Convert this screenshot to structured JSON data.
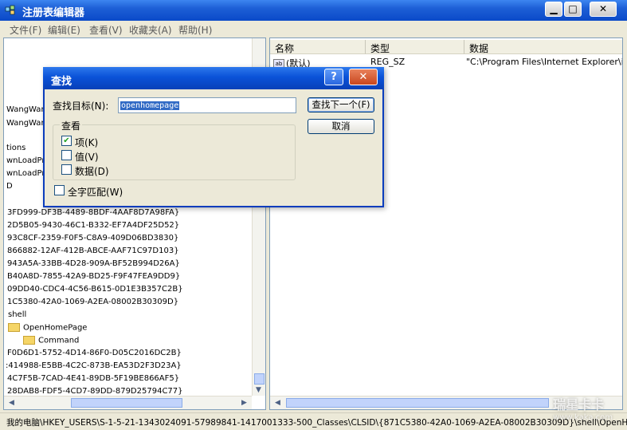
{
  "window": {
    "title": "注册表编辑器",
    "min_label": "▁",
    "max_label": "□",
    "close_label": "✕"
  },
  "menu": [
    "文件(F)",
    "编辑(E)",
    "查看(V)",
    "收藏夹(A)",
    "帮助(H)"
  ],
  "tree": [
    "WangWan",
    "WangWan",
    "tions",
    "wnLoadPro",
    "wnLoadPro",
    "D",
    "3FD999-DF3B-4489-8BDF-4AAF8D7A98FA}",
    "2D5B05-9430-46C1-B332-EF7A4DF25D52}",
    "93C8CF-2359-F0F5-C8A9-409D06BD3830}",
    "866882-12AF-412B-ABCE-AAF71C97D103}",
    "943A5A-33BB-4D28-909A-BF52B994D26A}",
    "B40A8D-7855-42A9-BD25-F9F47FEA9DD9}",
    "09DD40-CDC4-4C56-B615-0D1E3B357C2B}",
    "1C5380-42A0-1069-A2EA-08002B30309D}",
    "shell",
    "OpenHomePage",
    "Command",
    "F0D6D1-5752-4D14-86F0-D05C2016DC2B}",
    ":414988-E5BB-4C2C-873B-EA53D2F3D23A}",
    "4C7F5B-7CAD-4E41-89DB-5F19BE866AF5}",
    "28DAB8-FDF5-4CD7-89DD-879D25794C77}"
  ],
  "list": {
    "headers": [
      "名称",
      "类型",
      "数据"
    ],
    "rows": [
      {
        "icon": "ab",
        "name": "(默认)",
        "type": "REG_SZ",
        "data": "\"C:\\Program Files\\Internet Explorer\\iexp"
      }
    ]
  },
  "dialog": {
    "title": "查找",
    "help_label": "?",
    "close_label": "✕",
    "find_label": "查找目标(N):",
    "find_value": "openhomepage",
    "find_next": "查找下一个(F)",
    "cancel": "取消",
    "group_title": "查看",
    "options": [
      {
        "label": "项(K)",
        "checked": true
      },
      {
        "label": "值(V)",
        "checked": false
      },
      {
        "label": "数据(D)",
        "checked": false
      }
    ],
    "match_whole": {
      "label": "全字匹配(W)",
      "checked": false
    }
  },
  "status": "我的电脑\\HKEY_USERS\\S-1-5-21-1343024091-57989841-1417001333-500_Classes\\CLSID\\{871C5380-42A0-1069-A2EA-08002B30309D}\\shell\\OpenHome",
  "watermark": {
    "main": "瑞星卡卡",
    "sub": "www.kaka.com"
  }
}
